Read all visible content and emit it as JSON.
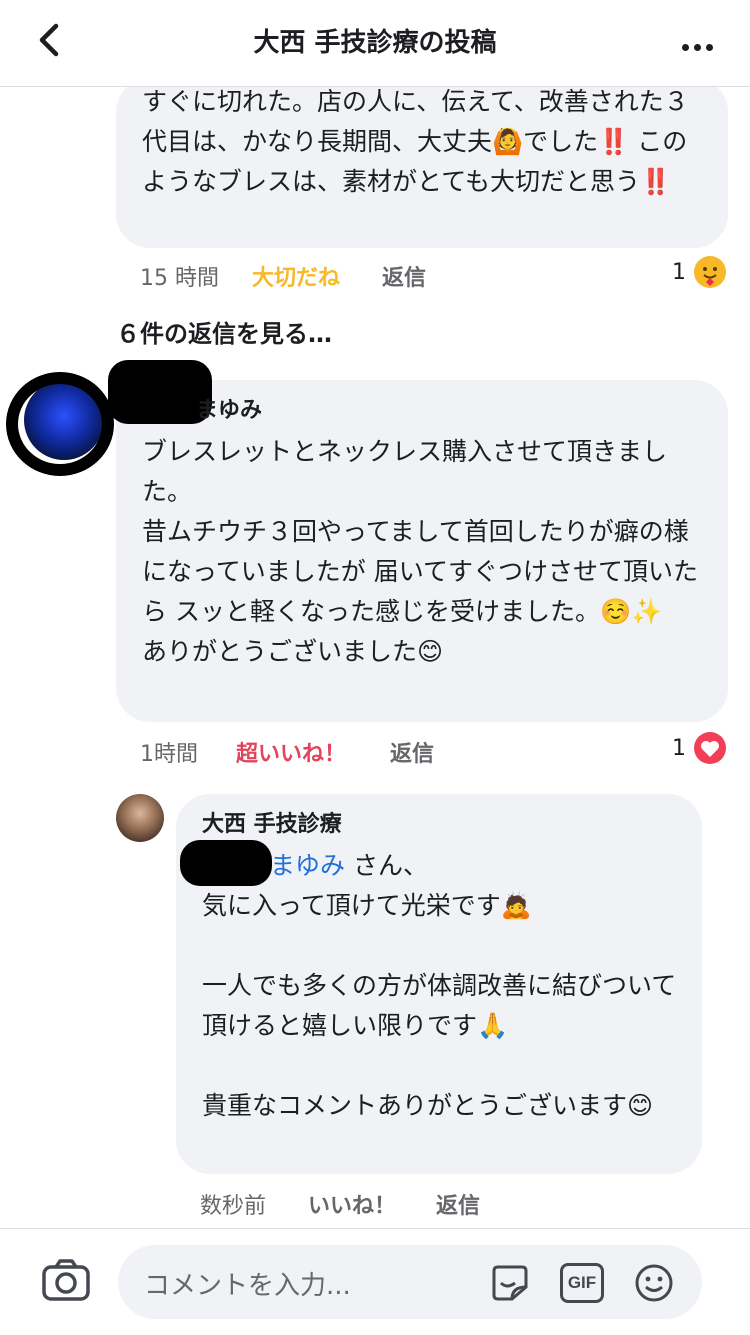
{
  "header": {
    "title": "大西 手技診療の投稿",
    "back_icon": "chevron-left-icon",
    "more_icon": "more-horizontal-icon"
  },
  "comment1": {
    "text": "すぐに切れた。店の人に、伝えて、改善された３代目は、かなり長期間、大丈夫🙆でした‼️ このようなブレスは、素材がとても大切だと思う‼️",
    "time": "15 時間",
    "reaction": "大切だね",
    "reply": "返信",
    "reaction_count": "1",
    "reaction_color": "#f7b928"
  },
  "view_replies": "６件の返信を見る…",
  "comment2": {
    "author": "まゆみ",
    "text": "ブレスレットとネックレス購入させて頂きました。\n昔ムチウチ３回やってまして首回したりが癖の様になっていましたが 届いてすぐつけさせて頂いたら スッと軽くなった感じを受けました。☺️✨\nありがとうございました😊",
    "time": "1時間",
    "reaction": "超いいね！",
    "reply": "返信",
    "reaction_count": "1",
    "reaction_color": "#e0455b"
  },
  "reply1": {
    "author": "大西 手技診療",
    "mention": "まゆみ",
    "mention_suffix": " さん、",
    "text": "気に入って頂けて光栄です🙇\n\n一人でも多くの方が体調改善に結びついて頂けると嬉しい限りです🙏\n\n貴重なコメントありがとうございます😊",
    "time": "数秒前",
    "like": "いいね！",
    "reply": "返信"
  },
  "composer": {
    "placeholder": "コメントを入力...",
    "camera_icon": "camera-icon",
    "sticker_icon": "sticker-icon",
    "gif_label": "GIF",
    "emoji_icon": "smiley-icon"
  },
  "colors": {
    "bubble": "#f0f2f5",
    "mention": "#216fdb",
    "secondary_text": "#65676b"
  }
}
